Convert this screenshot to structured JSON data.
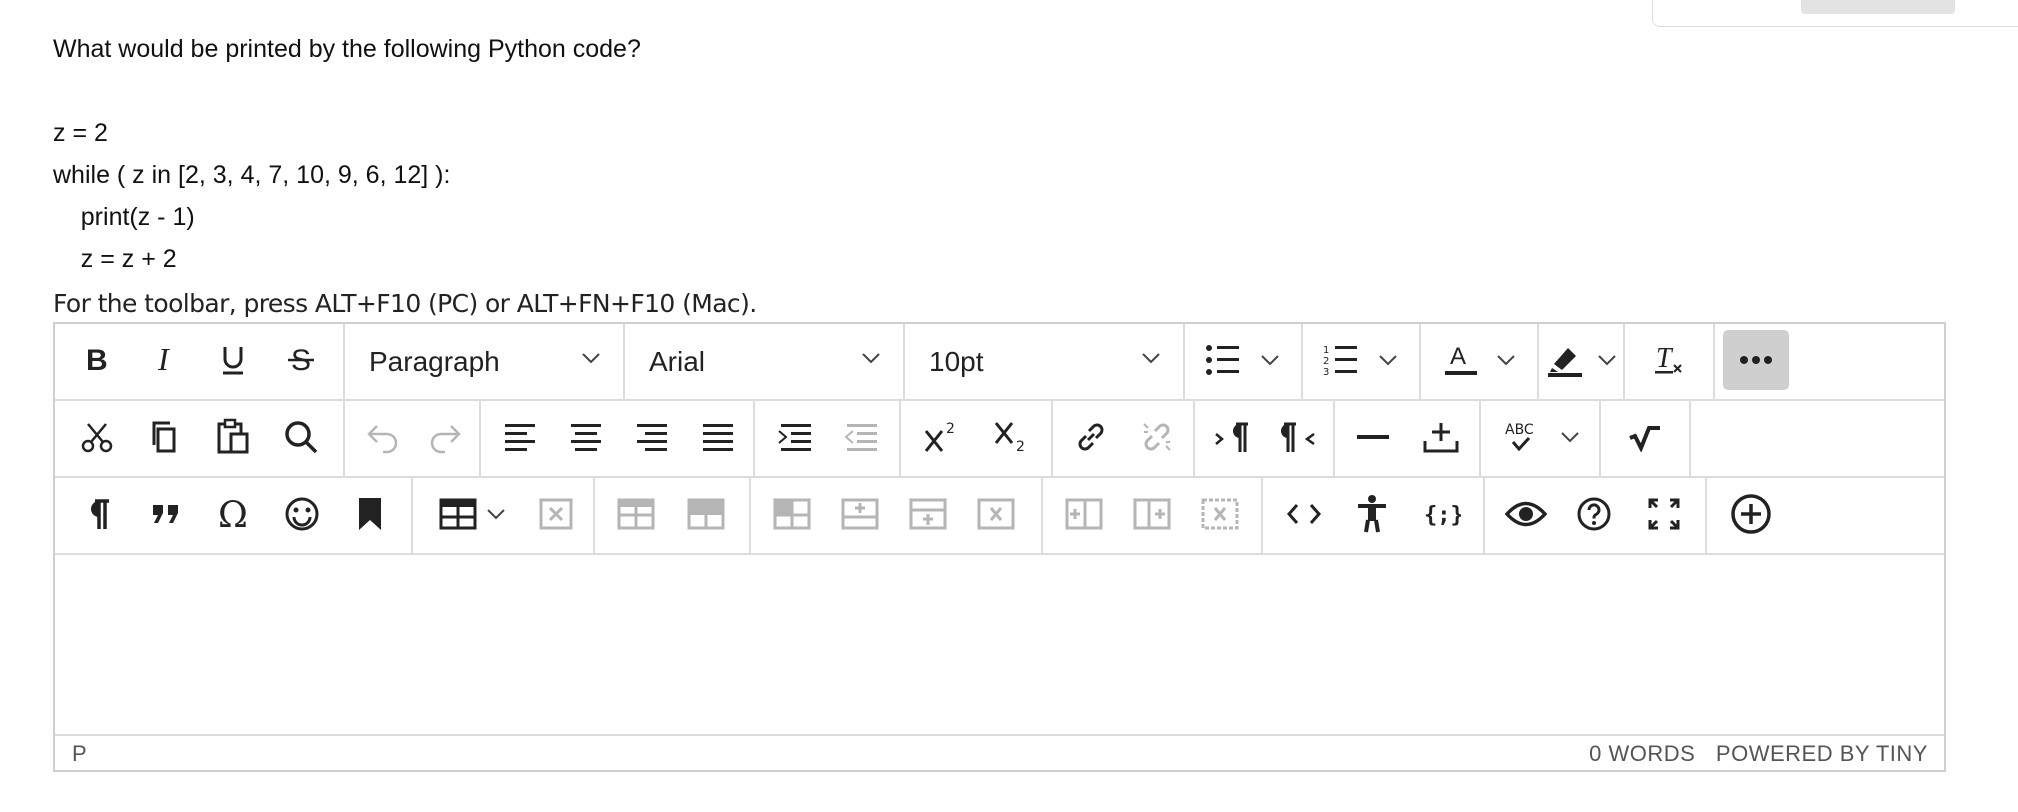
{
  "question": {
    "prompt": "What would be printed by the following Python code?",
    "code": [
      "z = 2",
      "while ( z in [2, 3, 4, 7, 10, 9, 6, 12] ):",
      "    print(z - 1)",
      "    z = z + 2"
    ]
  },
  "editor": {
    "toolbar_hint": "For the toolbar, press ALT+F10 (PC) or ALT+FN+F10 (Mac).",
    "block_format": "Paragraph",
    "font_family": "Arial",
    "font_size": "10pt",
    "status_path": "P",
    "word_count": "0 WORDS",
    "powered_by": "POWERED BY TINY"
  },
  "colors": {
    "border": "#cfcfcf",
    "disabled_icon": "#b5b5b5",
    "active_bg": "#cfcfcf"
  }
}
